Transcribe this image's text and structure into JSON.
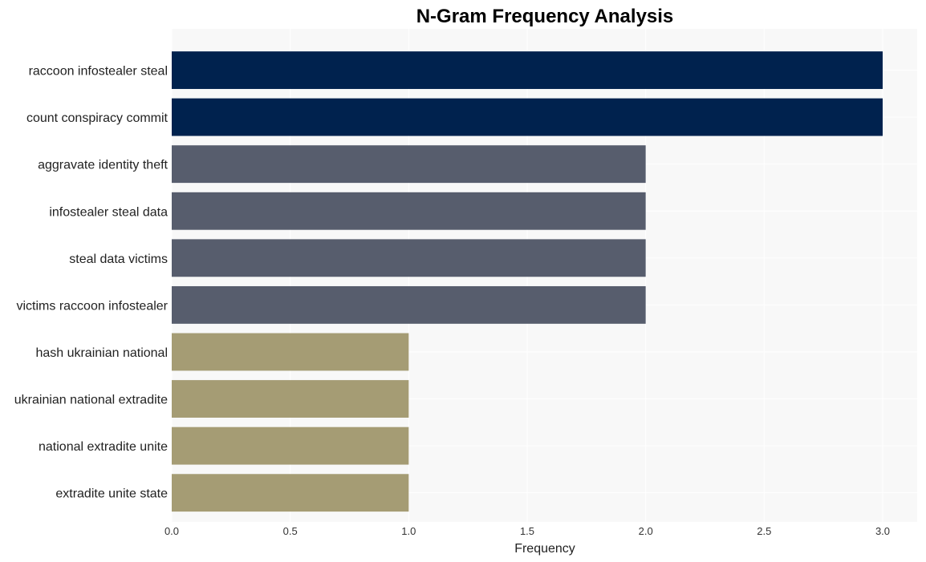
{
  "chart_data": {
    "type": "bar",
    "orientation": "horizontal",
    "title": "N-Gram Frequency Analysis",
    "xlabel": "Frequency",
    "ylabel": "",
    "xlim": [
      0,
      3.15
    ],
    "xticks": [
      "0.0",
      "0.5",
      "1.0",
      "1.5",
      "2.0",
      "2.5",
      "3.0"
    ],
    "grid": true,
    "categories": [
      "raccoon infostealer steal",
      "count conspiracy commit",
      "aggravate identity theft",
      "infostealer steal data",
      "steal data victims",
      "victims raccoon infostealer",
      "hash ukrainian national",
      "ukrainian national extradite",
      "national extradite unite",
      "extradite unite state"
    ],
    "values": [
      3,
      3,
      2,
      2,
      2,
      2,
      1,
      1,
      1,
      1
    ],
    "colors": {
      "3": "#00224e",
      "2": "#575d6d",
      "1": "#a59c74"
    },
    "background": "#f8f8f8",
    "gridColor": "#ffffff"
  }
}
